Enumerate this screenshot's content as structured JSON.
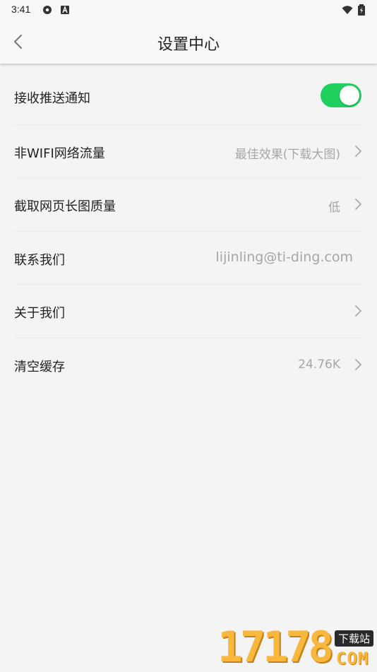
{
  "status_bar": {
    "time": "3:41",
    "icons": [
      "settings-gear-icon",
      "a-badge-icon",
      "wifi-icon",
      "battery-icon"
    ]
  },
  "app_bar": {
    "back_icon": "chevron-left-icon",
    "title": "设置中心"
  },
  "settings": {
    "push": {
      "label": "接收推送通知",
      "enabled": true
    },
    "non_wifi": {
      "label": "非WIFI网络流量",
      "value": "最佳效果(下载大图)"
    },
    "screenshot_quality": {
      "label": "截取网页长图质量",
      "value": "低"
    },
    "contact": {
      "label": "联系我们",
      "value": "lijinling@ti-ding.com"
    },
    "about": {
      "label": "关于我们"
    },
    "cache": {
      "label": "清空缓存",
      "value": "24.76K"
    }
  },
  "watermark": {
    "digits": "17178",
    "tag": "下载站",
    "domain": "COM"
  },
  "colors": {
    "toggle_on": "#20d05f",
    "background": "#f4f4f4",
    "secondary_text": "#a6a6a6"
  }
}
